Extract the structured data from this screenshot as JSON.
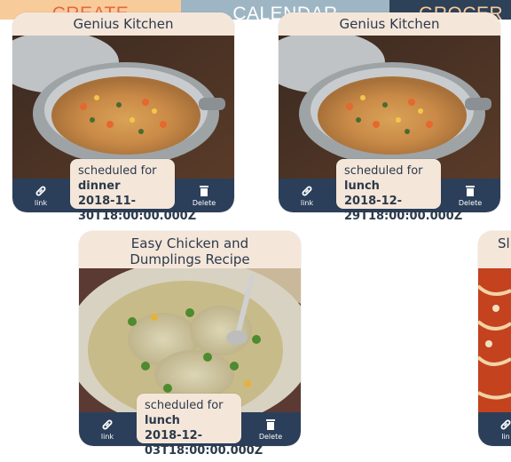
{
  "nav": {
    "create": "CREATE",
    "calendar": "CALENDAR",
    "grocery": "GROCER"
  },
  "colors": {
    "create_bg": "#f8cb9a",
    "calendar_bg": "#9eb6c4",
    "grocery_bg": "#2d4158",
    "card_bg": "#f5e6da",
    "bar_bg": "#2b3f5a"
  },
  "cards": [
    {
      "title": "Genius Kitchen",
      "schedule_label": "scheduled for",
      "meal": "dinner",
      "date": "2018-11-",
      "date2": "30T18:00:00.000Z",
      "link_label": "link",
      "delete_label": "Delete"
    },
    {
      "title": "Genius Kitchen",
      "schedule_label": "scheduled for",
      "meal": "lunch",
      "date": "2018-12-",
      "date2": "29T18:00:00.000Z",
      "link_label": "link",
      "delete_label": "Delete"
    },
    {
      "title": "Easy Chicken and Dumplings Recipe",
      "schedule_label": "scheduled for",
      "meal": "lunch",
      "date": "2018-12-",
      "date2": "03T18:00:00.000Z",
      "link_label": "link",
      "delete_label": "Delete"
    },
    {
      "title": "Sl",
      "link_label": "lin"
    }
  ]
}
